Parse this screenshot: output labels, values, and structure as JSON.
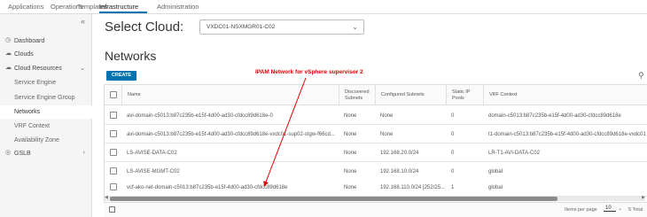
{
  "topnav": {
    "items": [
      "Applications",
      "Operations",
      "Templates",
      "Infrastructure",
      "Administration"
    ],
    "active": "Infrastructure"
  },
  "sidebar": {
    "collapse_glyph": "«",
    "items": [
      {
        "label": "Dashboard",
        "icon": "dashboard-icon"
      },
      {
        "label": "Clouds",
        "icon": "cloud-icon"
      },
      {
        "label": "Cloud Resources",
        "icon": "cloud-resources-icon"
      },
      {
        "label": "Service Engine"
      },
      {
        "label": "Service Engine Group"
      },
      {
        "label": "Networks"
      },
      {
        "label": "VRF Context"
      },
      {
        "label": "Availability Zone"
      },
      {
        "label": "GSLB",
        "icon": "gslb-icon"
      }
    ]
  },
  "select_cloud": {
    "label": "Select Cloud:",
    "value": "VXDC01-NSXMGR01-C02"
  },
  "page_title": "Networks",
  "create_button": "CREATE",
  "annotation": "IPAM Network for vSphere supervisor 2",
  "table": {
    "headers": {
      "name": "Name",
      "discovered": "Discovered Subnets",
      "configured": "Configured Subnets",
      "static_ip": "Static IP Pools",
      "vrf": "VRF Context"
    },
    "rows": [
      {
        "name": "avi-domain-c5013:b87c235b-e15f-4d00-ad30-cfdcc89d618e-0",
        "discovered": "None",
        "configured": "None",
        "static": "0",
        "vrf": "domain-c5013:b87c235b-e15f-4d00-ad30-cfdcc89d618e"
      },
      {
        "name": "avi-domain-c5013:b87c235b-e15f-4d00-ad30-cfdcc89d618e-vxdc01-sup02-stgw-f66cd...",
        "discovered": "None",
        "configured": "None",
        "static": "0",
        "vrf": "t1-domain-c5013:b87c235b-e15f-4d00-ad30-cfdcc89d618e-vxdc01"
      },
      {
        "name": "LS-AVISE-DATA-C02",
        "discovered": "None",
        "configured": "192.168.20.0/24",
        "static": "0",
        "vrf": "LR-T1-AVI-DATA-C02"
      },
      {
        "name": "LS-AVISE-MGMT-C02",
        "discovered": "None",
        "configured": "192.168.10.0/24",
        "static": "0",
        "vrf": "global"
      },
      {
        "name": "vcf-ako-net-domain-c5013:b87c235b-e15f-4d00-ad30-cfdcc89d618e",
        "discovered": "None",
        "configured": "192.168.110.0/24 [252/25...",
        "static": "1",
        "vrf": "global"
      }
    ]
  },
  "footer": {
    "items_per_page_label": "Items per page",
    "items_per_page": "10",
    "total": "5 Total"
  },
  "colors": {
    "accent": "#0073b1",
    "annotation": "#e00000"
  }
}
